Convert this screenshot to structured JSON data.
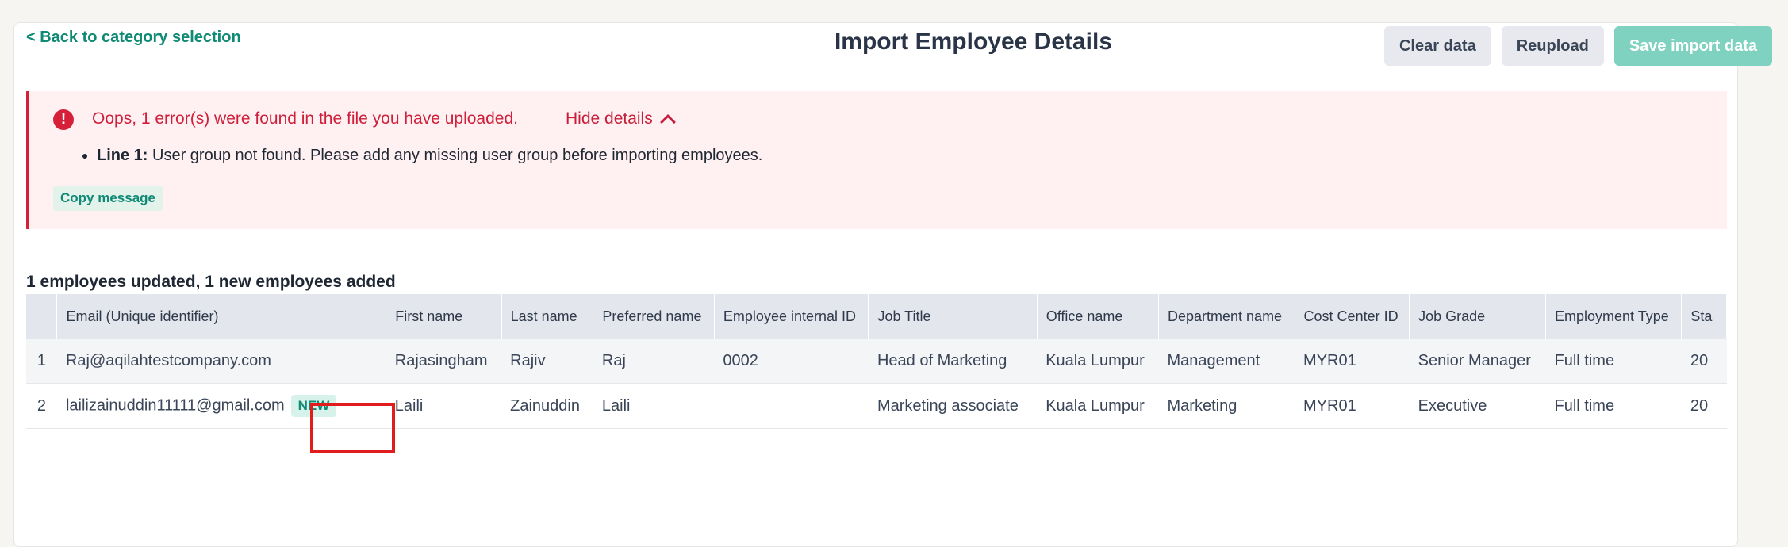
{
  "header": {
    "back_link": "< Back to category selection",
    "title": "Import Employee Details",
    "buttons": {
      "clear": "Clear data",
      "reupload": "Reupload",
      "save": "Save import data"
    }
  },
  "error": {
    "icon": "!",
    "headline": "Oops, 1 error(s) were found in the file you have uploaded.",
    "toggle": "Hide details",
    "items": [
      {
        "line": "Line 1:",
        "message": " User group not found. Please add any missing user group before importing employees."
      }
    ],
    "copy_label": "Copy message"
  },
  "summary": "1 employees updated, 1 new employees added",
  "table": {
    "columns": [
      "",
      "Email (Unique identifier)",
      "First name",
      "Last name",
      "Preferred name",
      "Employee internal ID",
      "Job Title",
      "Office name",
      "Department name",
      "Cost Center ID",
      "Job Grade",
      "Employment Type",
      "Sta"
    ],
    "rows": [
      {
        "index": "1",
        "email": "Raj@aqilahtestcompany.com",
        "badge": "",
        "first": "Rajasingham",
        "last": "Rajiv",
        "preferred": "Raj",
        "internal_id": "0002",
        "job_title": "Head of Marketing",
        "office": "Kuala Lumpur",
        "department": "Management",
        "cost_center": "MYR01",
        "job_grade": "Senior Manager",
        "employment_type": "Full time",
        "start": "20"
      },
      {
        "index": "2",
        "email": "lailizainuddin11111@gmail.com",
        "badge": "NEW",
        "first": "Laili",
        "last": "Zainuddin",
        "preferred": "Laili",
        "internal_id": "",
        "job_title": "Marketing associate",
        "office": "Kuala Lumpur",
        "department": "Marketing",
        "cost_center": "MYR01",
        "job_grade": "Executive",
        "employment_type": "Full time",
        "start": "20"
      }
    ]
  },
  "colors": {
    "accent": "#0f8a74",
    "error": "#d6203a",
    "error_bg": "#fff0f2",
    "primary_disabled": "#7fd1c0",
    "highlight": "#e11c1c"
  }
}
